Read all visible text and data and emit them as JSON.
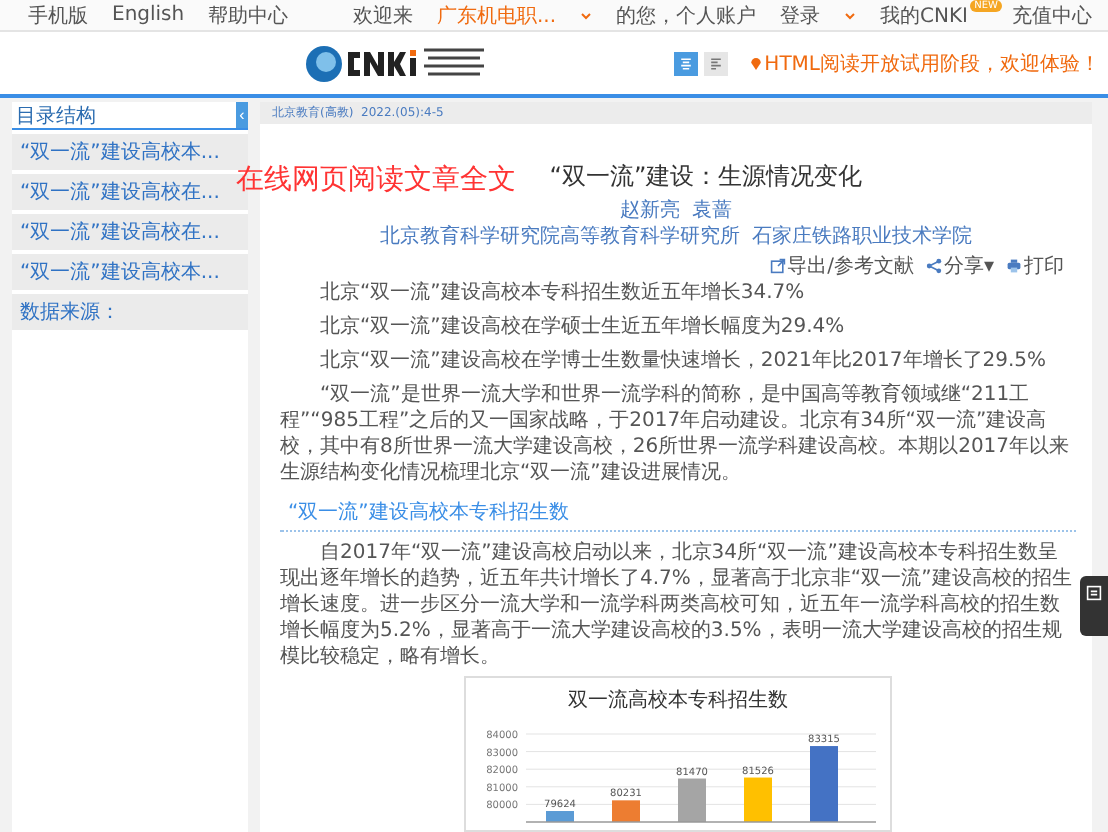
{
  "top_bar": {
    "left_links": [
      "手机版",
      "English",
      "帮助中心"
    ],
    "welcome": "欢迎来",
    "institution": "广东机电职...",
    "greeting": "的您，个人账户",
    "login": "登录",
    "my_cnki": "我的CNKI",
    "new_badge": "NEW",
    "recharge": "充值中心"
  },
  "header": {
    "view_modes": [
      {
        "kind": "single",
        "selected": true
      },
      {
        "kind": "list",
        "selected": false
      }
    ],
    "notice": "HTML阅读开放试用阶段，欢迎体验！"
  },
  "sidebar": {
    "title": "目录结构",
    "collapse": "‹",
    "items": [
      {
        "label": "“双一流”建设高校本..."
      },
      {
        "label": "“双一流”建设高校在..."
      },
      {
        "label": "“双一流”建设高校在..."
      },
      {
        "label": "“双一流”建设高校本..."
      }
    ],
    "source": "数据来源："
  },
  "article": {
    "source_line": "北京教育(高教)  2022.(05):4-5",
    "overlay_caption": "在线网页阅读文章全文",
    "title": "“双一流”建设：生源情况变化",
    "authors": "赵新亮  袁蔷",
    "affiliation": "北京教育科学研究院高等教育科学研究所  石家庄铁路职业技术学院",
    "tools": [
      {
        "kind": "export",
        "label": "导出/参考文献"
      },
      {
        "kind": "share",
        "label": "分享▾"
      },
      {
        "kind": "print",
        "label": "打印"
      }
    ],
    "highlights": [
      "北京“双一流”建设高校本专科招生数近五年增长34.7%",
      "北京“双一流”建设高校在学硕士生近五年增长幅度为29.4%",
      "北京“双一流”建设高校在学博士生数量快速增长，2021年比2017年增长了29.5%"
    ],
    "intro": "“双一流”是世界一流大学和世界一流学科的简称，是中国高等教育领域继“211工程”“985工程”之后的又一国家战略，于2017年启动建设。北京有34所“双一流”建设高校，其中有8所世界一流大学建设高校，26所世界一流学科建设高校。本期以2017年以来生源结构变化情况梳理北京“双一流”建设进展情况。",
    "section_heading": "“双一流”建设高校本专科招生数",
    "section_text": "自2017年“双一流”建设高校启动以来，北京34所“双一流”建设高校本专科招生数呈现出逐年增长的趋势，近五年共计增长了4.7%，显著高于北京非“双一流”建设高校的招生增长速度。进一步区分一流大学和一流学科两类高校可知，近五年一流学科高校的招生数增长幅度为5.2%，显著高于一流大学建设高校的3.5%，表明一流大学建设高校的招生规模比较稳定，略有增长。",
    "chart_data": {
      "type": "bar",
      "title": "双一流高校本专科招生数",
      "ylim": [
        79000,
        84000
      ],
      "yticks": [
        80000,
        81000,
        82000,
        83000,
        84000
      ],
      "data_labels": true,
      "grid": true,
      "values": [
        79624,
        80231,
        81470,
        81526,
        83315
      ],
      "colors": [
        "#5b9bd5",
        "#ed7d31",
        "#a5a5a5",
        "#ffc000",
        "#4472c4"
      ]
    }
  }
}
